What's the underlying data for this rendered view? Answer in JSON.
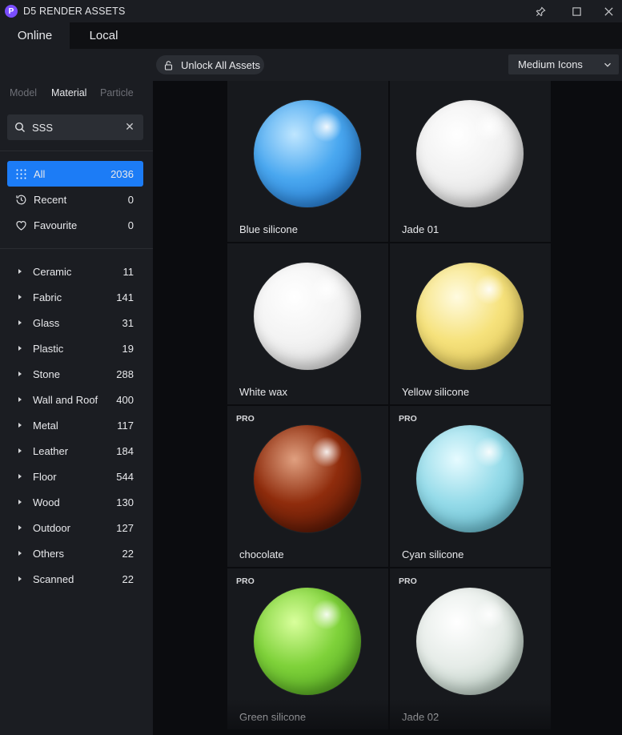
{
  "app": {
    "title": "D5 RENDER ASSETS",
    "logo_letter": "P"
  },
  "tabs": [
    {
      "label": "Online",
      "active": true
    },
    {
      "label": "Local",
      "active": false
    }
  ],
  "sidebar": {
    "asset_types": [
      {
        "label": "Model",
        "active": false
      },
      {
        "label": "Material",
        "active": true
      },
      {
        "label": "Particle",
        "active": false
      }
    ],
    "search": {
      "value": "SSS"
    },
    "quick_filters": [
      {
        "label": "All",
        "count": "2036",
        "icon": "grid-dots-icon",
        "active": true
      },
      {
        "label": "Recent",
        "count": "0",
        "icon": "history-icon",
        "active": false
      },
      {
        "label": "Favourite",
        "count": "0",
        "icon": "heart-icon",
        "active": false
      }
    ],
    "categories": [
      {
        "label": "Ceramic",
        "count": "11"
      },
      {
        "label": "Fabric",
        "count": "141"
      },
      {
        "label": "Glass",
        "count": "31"
      },
      {
        "label": "Plastic",
        "count": "19"
      },
      {
        "label": "Stone",
        "count": "288"
      },
      {
        "label": "Wall and Roof",
        "count": "400"
      },
      {
        "label": "Metal",
        "count": "117"
      },
      {
        "label": "Leather",
        "count": "184"
      },
      {
        "label": "Floor",
        "count": "544"
      },
      {
        "label": "Wood",
        "count": "130"
      },
      {
        "label": "Outdoor",
        "count": "127"
      },
      {
        "label": "Others",
        "count": "22"
      },
      {
        "label": "Scanned",
        "count": "22"
      }
    ]
  },
  "toolbar": {
    "unlock_label": "Unlock All Assets",
    "view_mode": "Medium Icons"
  },
  "materials": [
    {
      "name": "Blue silicone",
      "pro": "",
      "colors": [
        "#bfe6ff",
        "#4aa8f0",
        "#1465c2"
      ]
    },
    {
      "name": "Jade 01",
      "pro": "",
      "colors": [
        "#ffffff",
        "#f1f1f1",
        "#c9c9c9"
      ]
    },
    {
      "name": "White wax",
      "pro": "",
      "colors": [
        "#ffffff",
        "#f3f3f3",
        "#cfcfcf"
      ]
    },
    {
      "name": "Yellow silicone",
      "pro": "",
      "colors": [
        "#fffbe0",
        "#f6e27c",
        "#d3b84a"
      ]
    },
    {
      "name": "chocolate",
      "pro": "PRO",
      "colors": [
        "#e0a080",
        "#8f2c0c",
        "#3b0d03"
      ]
    },
    {
      "name": "Cyan silicone",
      "pro": "PRO",
      "colors": [
        "#e6fbff",
        "#95dbe9",
        "#4fa9bd"
      ]
    },
    {
      "name": "Green silicone",
      "pro": "PRO",
      "colors": [
        "#d9ff9c",
        "#7fd23a",
        "#3f9316"
      ]
    },
    {
      "name": "Jade 02",
      "pro": "PRO",
      "colors": [
        "#ffffff",
        "#e6ece8",
        "#9fb8aa"
      ]
    }
  ]
}
